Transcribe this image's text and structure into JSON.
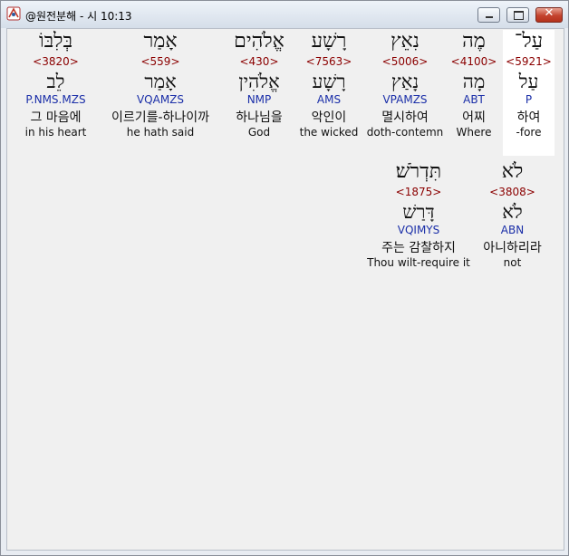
{
  "window": {
    "title": "@원전분해 - 시 10:13",
    "icon": "app-logo-icon",
    "controls": {
      "minimize": "minimize-icon",
      "maximize": "maximize-icon",
      "close": "close-icon",
      "close_glyph": "✕"
    }
  },
  "colors": {
    "strong": "#8b0000",
    "morph": "#1a2ea8",
    "text": "#111111",
    "selected": "#ffffff"
  },
  "rows": [
    {
      "words": [
        {
          "hebrew": "בְּלִבּוֹ",
          "strong": "<3820>",
          "root": "לֵב",
          "morph": "P.NMS.MZS",
          "korean": "그 마음에",
          "english": "in his heart"
        },
        {
          "hebrew": "אָמַר",
          "strong": "<559>",
          "root": "אָמַר",
          "morph": "VQAMZS",
          "korean": "이르기를-하나이까",
          "english": "he hath said"
        },
        {
          "hebrew": "אֱלֹהִים",
          "strong": "<430>",
          "root": "אֱלֹהִין",
          "morph": "NMP",
          "korean": "하나님을",
          "english": "God"
        },
        {
          "hebrew": "רָשָׁע",
          "strong": "<7563>",
          "root": "רָשָׁע",
          "morph": "AMS",
          "korean": "악인이",
          "english": "the wicked"
        },
        {
          "hebrew": "נִאֵץ",
          "strong": "<5006>",
          "root": "נָאַץ",
          "morph": "VPAMZS",
          "korean": "멸시하여",
          "english": "doth-contemn"
        },
        {
          "hebrew": "מֶה",
          "strong": "<4100>",
          "root": "מָה",
          "morph": "ABT",
          "korean": "어찌",
          "english": "Where"
        },
        {
          "hebrew": "עַל־",
          "strong": "<5921>",
          "root": "עַל",
          "morph": "P",
          "korean": "하여",
          "english": "-fore",
          "selected": true
        }
      ]
    },
    {
      "words": [
        {
          "hebrew": "תִּדְרֹשׁ׃",
          "strong": "<1875>",
          "root": "דָּרַשׁ",
          "morph": "VQIMYS",
          "korean": "주는 감찰하지",
          "english": "Thou wilt-require it"
        },
        {
          "hebrew": "לֹא",
          "strong": "<3808>",
          "root": "לֹא",
          "morph": "ABN",
          "korean": "아니하리라",
          "english": "not"
        }
      ]
    }
  ]
}
